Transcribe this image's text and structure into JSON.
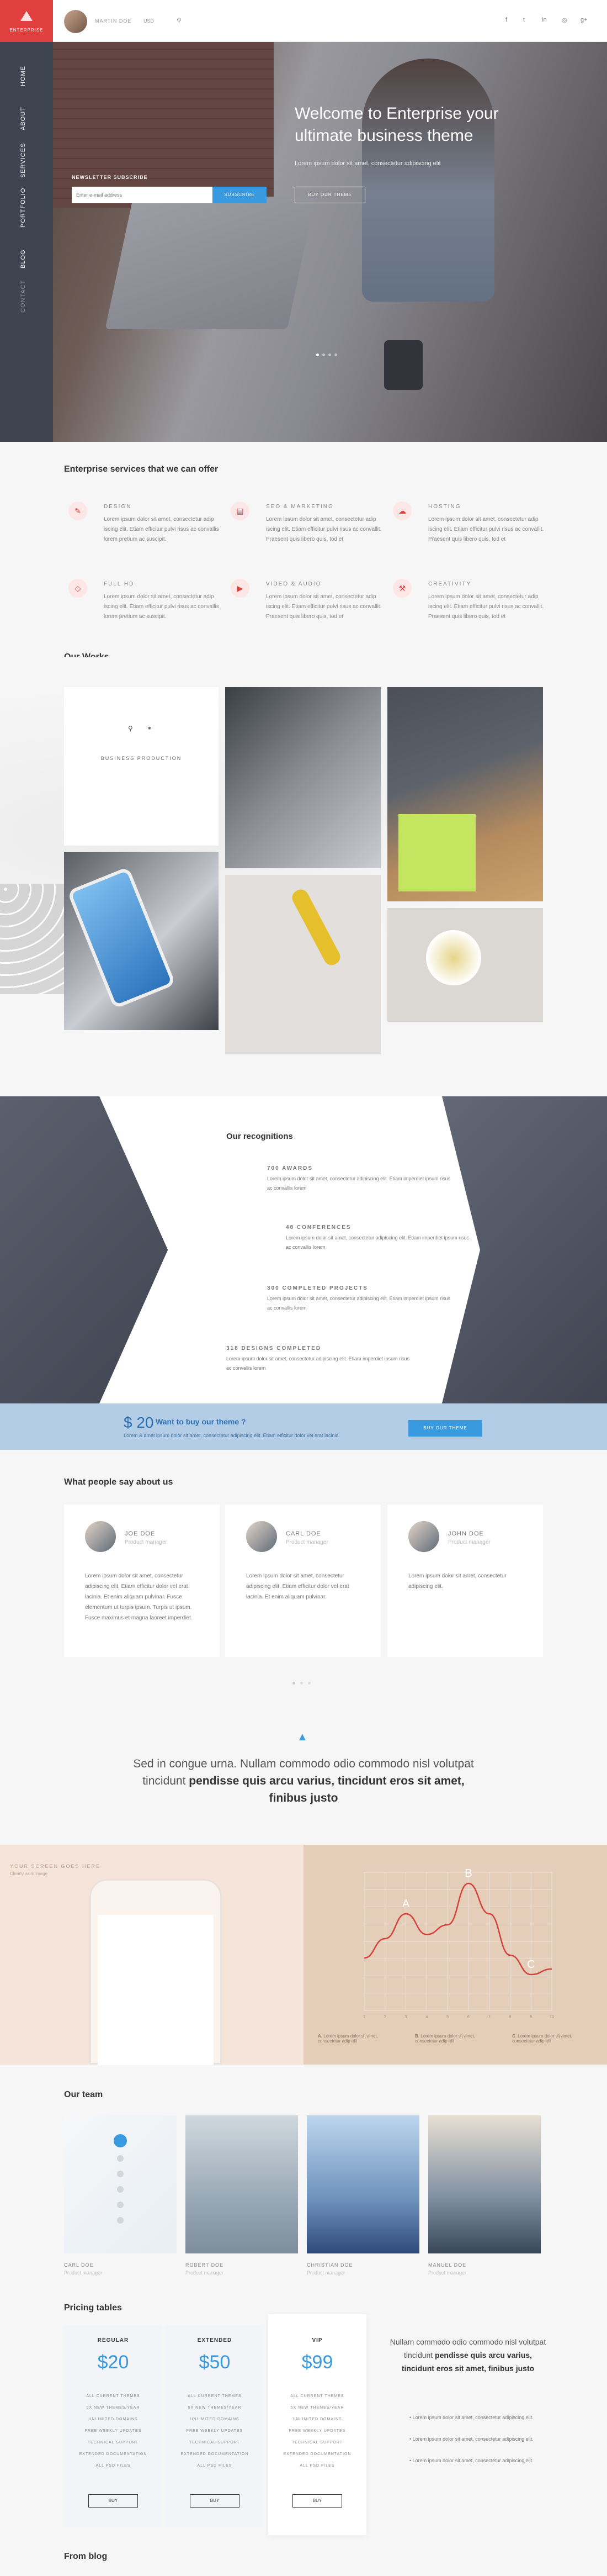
{
  "brand": {
    "logo_text": "ENTERPRISE",
    "accent": "#e0403d",
    "blue": "#3a9ae0"
  },
  "topbar": {
    "username": "MARTIN DOE",
    "currency": "USD",
    "social_icons": [
      "facebook-icon",
      "twitter-icon",
      "linkedin-icon",
      "dribbble-icon",
      "googleplus-icon"
    ]
  },
  "sidebar": {
    "items": [
      "HOME",
      "ABOUT",
      "SERVICES",
      "PORTFOLIO",
      "BLOG",
      "CONTACT"
    ]
  },
  "hero": {
    "title": "Welcome to Enterprise your ultimate business theme",
    "subtitle": "Lorem ipsum dolor sit amet, consectetur adipiscing elit",
    "button": "BUY OUR THEME",
    "newsletter_label": "NEWSLETTER SUBSCRIBE",
    "newsletter_placeholder": "Enter e-mail address",
    "newsletter_button": "SUBSCRIBE"
  },
  "services": {
    "title": "Enterprise services that we can offer",
    "items": [
      {
        "title": "DESIGN",
        "icon": "design-icon",
        "text": "Lorem ipsum dolor sit amet, consectetur adip iscing elit. Etiam efficitur pulvi risus ac convallis lorem pretium ac suscipit."
      },
      {
        "title": "SEO & MARKETING",
        "icon": "seo-icon",
        "text": "Lorem ipsum dolor sit amet, consectetur adip iscing elit. Etiam efficitur pulvi risus ac convallit. Praesent quis libero quis, tod et"
      },
      {
        "title": "HOSTING",
        "icon": "hosting-icon",
        "text": "Lorem ipsum dolor sit amet, consectetur adip iscing elit. Etiam efficitur pulvi risus ac convallit. Praesent quis libero quis, tod et"
      },
      {
        "title": "FULL HD",
        "icon": "fullhd-icon",
        "text": "Lorem ipsum dolor sit amet, consectetur adip iscing elit. Etiam efficitur pulvi risus ac convallis lorem pretium ac suscipit."
      },
      {
        "title": "VIDEO & AUDIO",
        "icon": "video-icon",
        "text": "Lorem ipsum dolor sit amet, consectetur adip iscing elit. Etiam efficitur pulvi risus ac convallit. Praesent quis libero quis, tod et"
      },
      {
        "title": "CREATIVITY",
        "icon": "creativity-icon",
        "text": "Lorem ipsum dolor sit amet, consectetur adip iscing elit. Etiam efficitur pulvi risus ac convallit. Praesent quis libero quis, tod et"
      }
    ]
  },
  "works": {
    "title": "Our Works",
    "featured_label": "BUSINESS PRODUCTION"
  },
  "recognitions": {
    "title": "Our recognitions",
    "items": [
      {
        "title": "700 AWARDS",
        "text": "Lorem ipsum dolor sit amet, consectetur adipiscing elit. Etiam imperdiet ipsum risus ac convallis lorem"
      },
      {
        "title": "48 CONFERENCES",
        "text": "Lorem ipsum dolor sit amet, consectetur adipiscing elit. Etiam imperdiet ipsum risus ac convallis lorem"
      },
      {
        "title": "300 COMPLETED PROJECTS",
        "text": "Lorem ipsum dolor sit amet, consectetur adipiscing elit. Etiam imperdiet ipsum risus ac convallis lorem"
      },
      {
        "title": "318 DESIGNS COMPLETED",
        "text": "Lorem ipsum dolor sit amet, consectetur adipiscing elit. Etiam imperdiet ipsum risus ac convallis lorem"
      }
    ]
  },
  "buybar": {
    "price": "$ 20",
    "question": "Want to buy our theme ?",
    "text": "Lorem & amet ipsum dolor sit amet, consectetur adipiscing elit. Etiam efficitur dolor vel erat lacinia.",
    "button": "BUY OUR THEME"
  },
  "testimonials": {
    "title": "What people say about us",
    "items": [
      {
        "name": "JOE DOE",
        "role": "Product manager",
        "text": "Lorem ipsum dolor sit amet, consectetur adipiscing elit. Etiam efficitur dolor vel erat lacinia. Et enim aliquam pulvinar. Fusce elementum ut turpis ipsum. Turpis ut ipsum. Fusce maximus et magna laoreet imperdiet."
      },
      {
        "name": "CARL DOE",
        "role": "Product manager",
        "text": "Lorem ipsum dolor sit amet, consectetur adipiscing elit. Etiam efficitur dolor vel erat lacinia. Et enim aliquam pulvinar."
      },
      {
        "name": "JOHN DOE",
        "role": "Product manager",
        "text": "Lorem ipsum dolor sit amet, consectetur adipiscing elit."
      }
    ]
  },
  "quote": {
    "normal": "Sed in congue urna. Nullam commodo odio commodo nisl volutpat tincidunt ",
    "bold": "pendisse quis arcu varius, tincidunt eros sit amet, finibus justo"
  },
  "device": {
    "label": "YOUR SCREEN GOES HERE",
    "sublabel": "Clearly work image"
  },
  "chart_data": {
    "type": "line",
    "x": [
      1,
      2,
      3,
      4,
      5,
      6,
      7,
      8,
      9,
      10
    ],
    "series": [
      {
        "values": [
          38,
          52,
          70,
          55,
          62,
          92,
          70,
          40,
          26,
          30
        ]
      }
    ],
    "annotations": [
      "A",
      "B",
      "C"
    ],
    "ylim": [
      0,
      100
    ],
    "legend": [
      {
        "label": "A",
        "text": "Lorem ipsum dolor sit amet, consectetur adip elit"
      },
      {
        "label": "B",
        "text": "Lorem ipsum dolor sit amet, consectetur adip elit"
      },
      {
        "label": "C",
        "text": "Lorem ipsum dolor sit amet, consectetur adip elit"
      }
    ]
  },
  "team": {
    "title": "Our team",
    "members": [
      {
        "name": "CARL DOE",
        "role": "Product manager"
      },
      {
        "name": "ROBERT DOE",
        "role": "Product manager"
      },
      {
        "name": "CHRISTIAN DOE",
        "role": "Product manager"
      },
      {
        "name": "MANUEL DOE",
        "role": "Product manager"
      }
    ]
  },
  "pricing": {
    "title": "Pricing tables",
    "plans": [
      {
        "name": "REGULAR",
        "price": "$20",
        "features": [
          "ALL CURRENT THEMES",
          "5X NEW THEMES/YEAR",
          "UNLIMITED DOMAINS",
          "FREE WEEKLY UPDATES",
          "TECHNICAL SUPPORT",
          "EXTENDED DOCUMENTATION",
          "ALL PSD FILES"
        ],
        "button": "BUY"
      },
      {
        "name": "EXTENDED",
        "price": "$50",
        "features": [
          "ALL CURRENT THEMES",
          "5X NEW THEMES/YEAR",
          "UNLIMITED DOMAINS",
          "FREE WEEKLY UPDATES",
          "TECHNICAL SUPPORT",
          "EXTENDED DOCUMENTATION",
          "ALL PSD FILES"
        ],
        "button": "BUY"
      },
      {
        "name": "VIP",
        "price": "$99",
        "features": [
          "ALL CURRENT THEMES",
          "5X NEW THEMES/YEAR",
          "UNLIMITED DOMAINS",
          "FREE WEEKLY UPDATES",
          "TECHNICAL SUPPORT",
          "EXTENDED DOCUMENTATION",
          "ALL PSD FILES"
        ],
        "button": "BUY"
      }
    ],
    "side_text_normal": "Nullam commodo odio commodo nisl volutpat tincidunt ",
    "side_text_bold": "pendisse quis arcu varius, tincidunt eros sit amet, finibus justo",
    "bullets": [
      "Lorem ipsum dolor sit amet, consectetur adipiscing elit.",
      "Lorem ipsum dolor sit amet, consectetur adipiscing elit.",
      "Lorem ipsum dolor sit amet, consectetur adipiscing elit."
    ]
  },
  "blog": {
    "title": "From blog"
  }
}
